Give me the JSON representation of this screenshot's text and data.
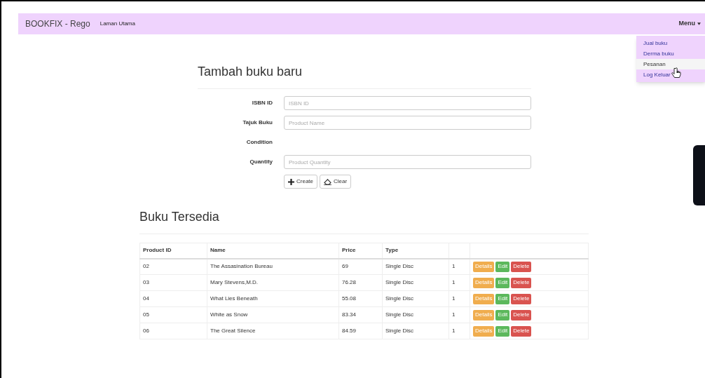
{
  "navbar": {
    "brand": "BOOKFIX - Rego",
    "links": [
      "Laman Utama"
    ],
    "menu": "Menu"
  },
  "dropdown": {
    "items": [
      {
        "label": "Jual buku",
        "selected": false
      },
      {
        "label": "Derma buku",
        "selected": false
      },
      {
        "label": "Pesanan",
        "selected": true
      },
      {
        "label": "Log Keluar",
        "selected": false
      }
    ]
  },
  "form": {
    "title": "Tambah buku baru",
    "fields": [
      {
        "label": "ISBN ID",
        "kind": "input",
        "placeholder": "ISBN ID"
      },
      {
        "label": "Tajuk Buku",
        "kind": "input",
        "placeholder": "Product Name"
      },
      {
        "label": "Condition",
        "kind": "none"
      },
      {
        "label": "Quantity",
        "kind": "input",
        "placeholder": "Product Quantity"
      }
    ],
    "buttons": [
      {
        "label": "Create",
        "kind": "create"
      },
      {
        "label": "Clear",
        "kind": "clear"
      }
    ]
  },
  "table": {
    "title": "Buku Tersedia",
    "columns": [
      "Product ID",
      "Name",
      "Price",
      "Type"
    ],
    "rows": [
      {
        "id": "02",
        "name": "The Assasination Bureau",
        "price": "69",
        "type": "Single Disc",
        "column_5": "1",
        "actions": [
          "Details",
          "Edit",
          "Delete"
        ]
      },
      {
        "id": "03",
        "name": "Mary Stevens,M.D.",
        "price": "76.28",
        "type": "Single Disc",
        "column_5": "1",
        "actions": [
          "Details",
          "Edit",
          "Delete"
        ]
      },
      {
        "id": "04",
        "name": "What Lies Beneath",
        "price": "55.08",
        "type": "Single Disc",
        "column_5": "1",
        "actions": [
          "Details",
          "Edit",
          "Delete"
        ]
      },
      {
        "id": "05",
        "name": "White as Snow",
        "price": "83.34",
        "type": "Single Disc",
        "column_5": "1",
        "actions": [
          "Details",
          "Edit",
          "Delete"
        ]
      },
      {
        "id": "06",
        "name": "The Great Silence",
        "price": "84.59",
        "type": "Single Disc",
        "column_5": "1",
        "actions": [
          "Details",
          "Edit",
          "Delete"
        ]
      }
    ]
  }
}
